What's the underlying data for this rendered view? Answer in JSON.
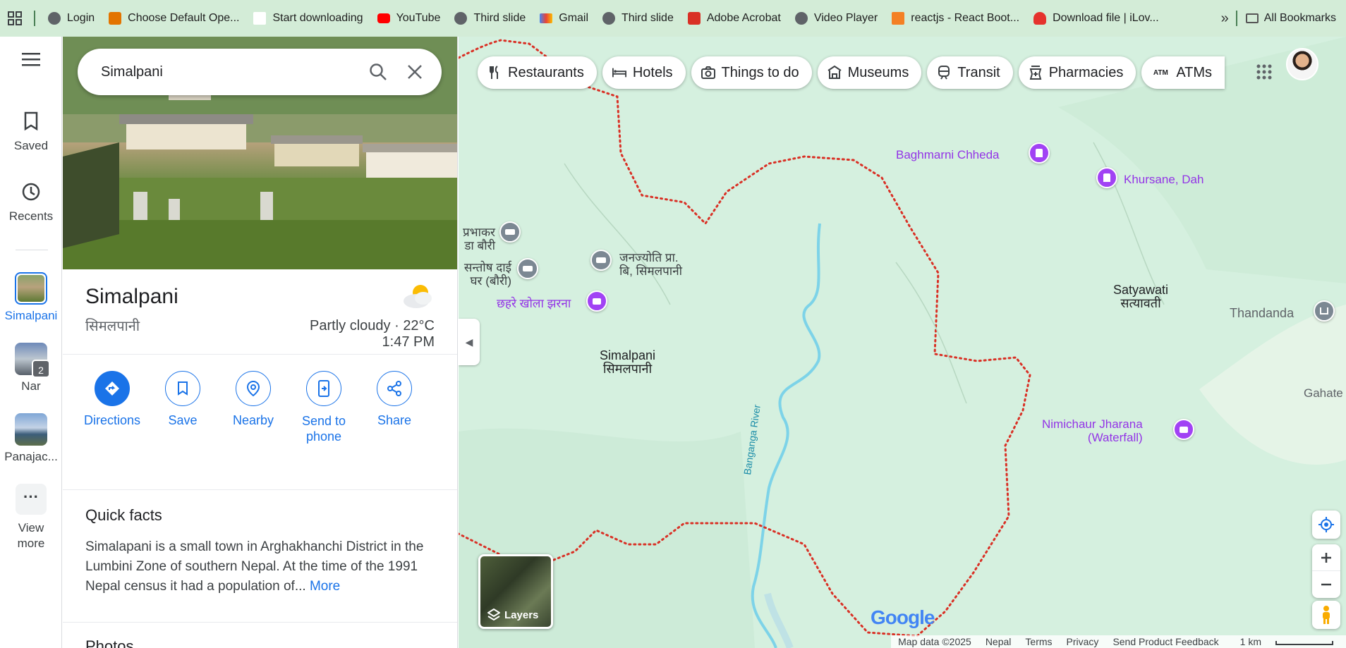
{
  "bookmarks": {
    "items": [
      {
        "label": "Login",
        "color": "#5f6368"
      },
      {
        "label": "Choose Default Ope...",
        "color": "#e37400"
      },
      {
        "label": "Start downloading",
        "color": "#ffffff"
      },
      {
        "label": "YouTube",
        "color": "#ff0000"
      },
      {
        "label": "Third slide",
        "color": "#5f6368"
      },
      {
        "label": "Gmail",
        "color": "#ea4335"
      },
      {
        "label": "Third slide",
        "color": "#5f6368"
      },
      {
        "label": "Adobe Acrobat",
        "color": "#d93025"
      },
      {
        "label": "Video Player",
        "color": "#5f6368"
      },
      {
        "label": "reactjs - React Boot...",
        "color": "#f48024"
      },
      {
        "label": "Download file | iLov...",
        "color": "#e5322d"
      }
    ],
    "more": "»",
    "all_bookmarks": "All Bookmarks"
  },
  "rail": {
    "saved": "Saved",
    "recents": "Recents",
    "recent_places": [
      {
        "label": "Simalpani",
        "active": true
      },
      {
        "label": "Nar",
        "badge": "2"
      },
      {
        "label": "Panajac..."
      }
    ],
    "view_more": "View more"
  },
  "search": {
    "value": "Simalpani"
  },
  "place": {
    "name": "Simalpani",
    "native_name": "सिमलपानी",
    "weather": "Partly cloudy · 22°C",
    "time": "1:47 PM"
  },
  "actions": [
    {
      "label": "Directions",
      "icon": "directions-icon"
    },
    {
      "label": "Save",
      "icon": "bookmark-icon"
    },
    {
      "label": "Nearby",
      "icon": "nearby-icon"
    },
    {
      "label": "Send to phone",
      "icon": "send-to-phone-icon"
    },
    {
      "label": "Share",
      "icon": "share-icon"
    }
  ],
  "quick_facts": {
    "title": "Quick facts",
    "text": "Simalapani is a small town in Arghakhanchi District in the Lumbini Zone of southern Nepal. At the time of the 1991 Nepal census it had a population of...",
    "more": "More"
  },
  "photos": {
    "title": "Photos"
  },
  "chips": [
    {
      "label": "Restaurants",
      "icon": "fork-knife-icon"
    },
    {
      "label": "Hotels",
      "icon": "bed-icon"
    },
    {
      "label": "Things to do",
      "icon": "camera-icon"
    },
    {
      "label": "Museums",
      "icon": "museum-icon"
    },
    {
      "label": "Transit",
      "icon": "train-icon"
    },
    {
      "label": "Pharmacies",
      "icon": "pharmacy-icon"
    },
    {
      "label": "ATMs",
      "icon": "atm-icon"
    }
  ],
  "map_labels": {
    "baghmarni": "Baghmarni Chheda",
    "khursane": "Khursane, Dah",
    "prabhakar_1": "प्रभाकर",
    "prabhakar_2": "डा बौरी",
    "santosh_1": "सन्तोष दाई",
    "santosh_2": "घर (बौरी)",
    "janajyoti_1": "जनज्योति प्रा.",
    "janajyoti_2": "बि, सिमलपानी",
    "chahare": "छहरे खोला झरना",
    "simalpani": "Simalpani",
    "simalpani_np": "सिमलपानी",
    "satyawati": "Satyawati",
    "satyawati_np": "सत्यावती",
    "thandanda": "Thandanda",
    "gahate": "Gahate m",
    "nimichaur_1": "Nimichaur Jharana",
    "nimichaur_2": "(Waterfall)",
    "river": "Banganga River"
  },
  "layers": "Layers",
  "google": "Google",
  "footer": {
    "map_data": "Map data ©2025",
    "country": "Nepal",
    "terms": "Terms",
    "privacy": "Privacy",
    "feedback": "Send Product Feedback",
    "scale": "1 km"
  },
  "colors": {
    "accent": "#1a73e8",
    "poi_purple": "#9334e6",
    "border": "#d93025",
    "map_bg": "#d5f0df",
    "bookmarks_bg": "#d3ecd7"
  }
}
